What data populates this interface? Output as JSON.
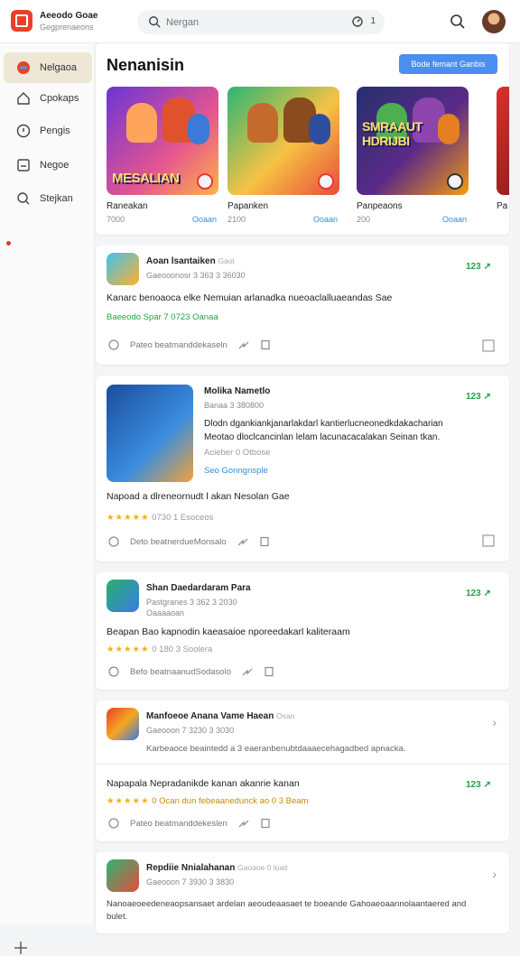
{
  "app": {
    "name": "Aeeodo Goae",
    "subtitle": "Gegprenaeons"
  },
  "search": {
    "placeholder": "Nergan",
    "filter_count": "1"
  },
  "sidebar": {
    "items": [
      {
        "label": "Nelgaoa",
        "icon": "gamepad-icon",
        "active": true
      },
      {
        "label": "Cpokaps",
        "icon": "home-icon"
      },
      {
        "label": "Pengis",
        "icon": "compass-icon"
      },
      {
        "label": "Negoe",
        "icon": "inbox-icon"
      },
      {
        "label": "Stejkan",
        "icon": "search-icon",
        "notification": true
      }
    ]
  },
  "featured": {
    "title": "Nenanisin",
    "button": "Bode femant Ganbis",
    "cards": [
      {
        "caption": "MESALIAN",
        "name": "Raneakan",
        "meta": "7000",
        "action": "Ooaan"
      },
      {
        "caption": "",
        "name": "Papanken",
        "meta": "2100",
        "action": "Ooaan"
      },
      {
        "caption": "SMRAAUT HDRIJBI",
        "name": "Panpeaons",
        "meta": "200",
        "action": "Ooaan"
      },
      {
        "caption": "",
        "name": "Pa",
        "meta": "",
        "action": ""
      }
    ]
  },
  "posts": [
    {
      "name": "Aoan lsantaiken",
      "verified": "Gaot",
      "sub": "Gaeooonosr 3 363 3 36030",
      "score": "123",
      "body": "Kanarc benoaoca elke Nemuian arlanadka nueoaclalluaeandas Sae",
      "rating": "Baeeodo Spar 7 0723 Oanaa",
      "actions": "Pateo beatmanddekaseln"
    },
    {
      "name": "Molika Nametlo",
      "sub": "Banaa 3 380800",
      "score": "123",
      "desc1": "Dlodn dgankiankjanarlakdarl kantierlucneonedkdakacharian",
      "desc2": "Meotao dloclcancinlan lelam lacunacacalakan Seinan tkan.",
      "rating_line": "Acieber 0 Otbose",
      "link": "Seo Gonngnsple",
      "body": "Napoad a dlreneornudt l akan Nesolan Gae",
      "rating": "0730 1 Esoceos",
      "actions": "Deto beatnerdueMonsalo"
    },
    {
      "name": "Shan Daedardaram Para",
      "sub": "Pastgranes 3 362 3 2030",
      "extra": "Oaaaaoan",
      "score": "123",
      "body": "Beapan Bao kapnodin kaeasaioe nporeedakarl kaliteraam",
      "rating": "0 180 3 Soolera",
      "actions": "Befo beatnaanudSodasolo"
    },
    {
      "name": "Manfoeoe Anana Vame Haean",
      "verified": "Osan",
      "sub": "Gaeooon 7 3230 3 3030",
      "desc1": "Karbeaoce beaintedd a 3 eaeranbenubtdaaaecehagadbed apnacka.",
      "body": "Napapala Nepradanikde kanan akanrie kanan",
      "rating": "0 Ocan dun febeaanedunck ao 0 3 Beam",
      "score": "123",
      "actions": "Pateo beatmanddekeslen"
    },
    {
      "name": "Repdiie Nnialahanan",
      "verified": "Gaoaoe 0 loait",
      "sub": "Gaeooon 7 3930 3 3830",
      "desc1": "Nanoaeoeedeneaopsansaet ardelan aeoudeaasaet te boeande Gahoaeoaannolaantaered and",
      "desc2": "bulet."
    }
  ],
  "colors": {
    "accent": "#4b8ef0",
    "score": "#24a148",
    "stars": "#f2b01e",
    "logo": "#e8402a"
  }
}
